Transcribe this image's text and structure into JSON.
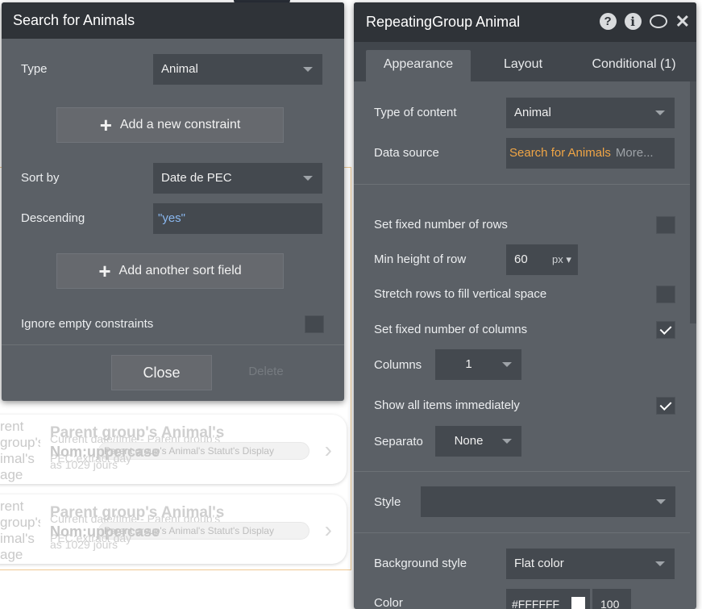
{
  "canvas": {
    "cards": [
      {
        "side_text": "rent\ngroup's\nimal's\nage",
        "title": "Parent group's Animal's",
        "line2": "Current date/time - Parent group's",
        "line3": "Nom:uppercase",
        "badge": "Parent group's Animal's Statut's Display",
        "line4": "PEC:extract day",
        "line5": "as 1029 jours"
      },
      {
        "side_text": "rent\ngroup's\nimal's\nage",
        "title": "Parent group's Animal's",
        "line2": "Current date/time - Parent group's",
        "line3": "Nom:uppercase",
        "badge": "Parent group's Animal's Statut's Display",
        "line4": "PEC:extract day",
        "line5": "as 1029 jours"
      }
    ]
  },
  "search_panel": {
    "title": "Search for Animals",
    "type_label": "Type",
    "type_value": "Animal",
    "add_constraint": "Add a new constraint",
    "sort_by_label": "Sort by",
    "sort_by_value": "Date de PEC",
    "descending_label": "Descending",
    "descending_value": "\"yes\"",
    "add_sort": "Add another sort field",
    "ignore_empty_label": "Ignore empty constraints",
    "ignore_empty_checked": false,
    "close": "Close",
    "delete": "Delete"
  },
  "rg_panel": {
    "title": "RepeatingGroup Animal",
    "icons": [
      "help-icon",
      "info-icon",
      "comment-icon",
      "close-icon"
    ],
    "tabs": [
      "Appearance",
      "Layout",
      "Conditional (1)"
    ],
    "active_tab": "Appearance",
    "type_of_content_label": "Type of content",
    "type_of_content_value": "Animal",
    "data_source_label": "Data source",
    "data_source_value": "Search for Animals",
    "data_source_more": "More...",
    "fixed_rows_label": "Set fixed number of rows",
    "fixed_rows_checked": false,
    "min_height_label": "Min height of row",
    "min_height_value": "60",
    "min_height_unit": "px",
    "stretch_label": "Stretch rows to fill vertical space",
    "stretch_checked": false,
    "fixed_cols_label": "Set fixed number of columns",
    "fixed_cols_checked": true,
    "columns_label": "Columns",
    "columns_value": "1",
    "show_all_label": "Show all items immediately",
    "show_all_checked": true,
    "separator_label": "Separato",
    "separator_value": "None",
    "style_label": "Style",
    "style_value": "",
    "bg_style_label": "Background style",
    "bg_style_value": "Flat color",
    "color_label": "Color",
    "color_hex": "#FFFFFF",
    "color_opacity": "100"
  },
  "colors": {
    "panel_bg": "#5b6066",
    "title_bg": "#2f3338",
    "field_bg": "#44494f",
    "data_source_accent": "#f0a545",
    "link_blue": "#8ab8f0"
  }
}
